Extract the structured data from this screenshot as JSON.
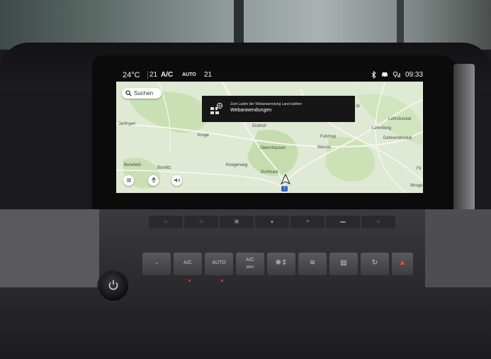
{
  "status_bar": {
    "temperature": "24°C",
    "fan_level": "21",
    "ac": "A/C",
    "auto": "AUTO",
    "second_temp": "21",
    "time": "09:33"
  },
  "map": {
    "search_label": "Suchen",
    "places": [
      "Jarlingen",
      "Kroge",
      "Eickhof",
      "Fuhrhop",
      "Obernhausen",
      "Wense",
      "Benefeld",
      "Bomlitz",
      "Kriegerweg",
      "Dorfmark",
      "Lührsbockel",
      "Lehmberg",
      "Dehnernbockel",
      "Fli",
      "Wroge",
      "ck"
    ],
    "route_shield": "7"
  },
  "toast": {
    "subtitle": "Zum Laden der Webanwendung Land wählen",
    "title": "Webanwendungen"
  },
  "console": {
    "top_buttons": [
      "seat-heat-icon",
      "steering-heat-icon",
      "car-icon",
      "home-icon",
      "lane-icon",
      "defrost-icon",
      "seat-icon"
    ],
    "bottom_buttons": {
      "ac_label": "A/C",
      "auto_label": "AUTO",
      "ac_max_label": "A/C",
      "ac_max_sub": "MAX"
    }
  }
}
